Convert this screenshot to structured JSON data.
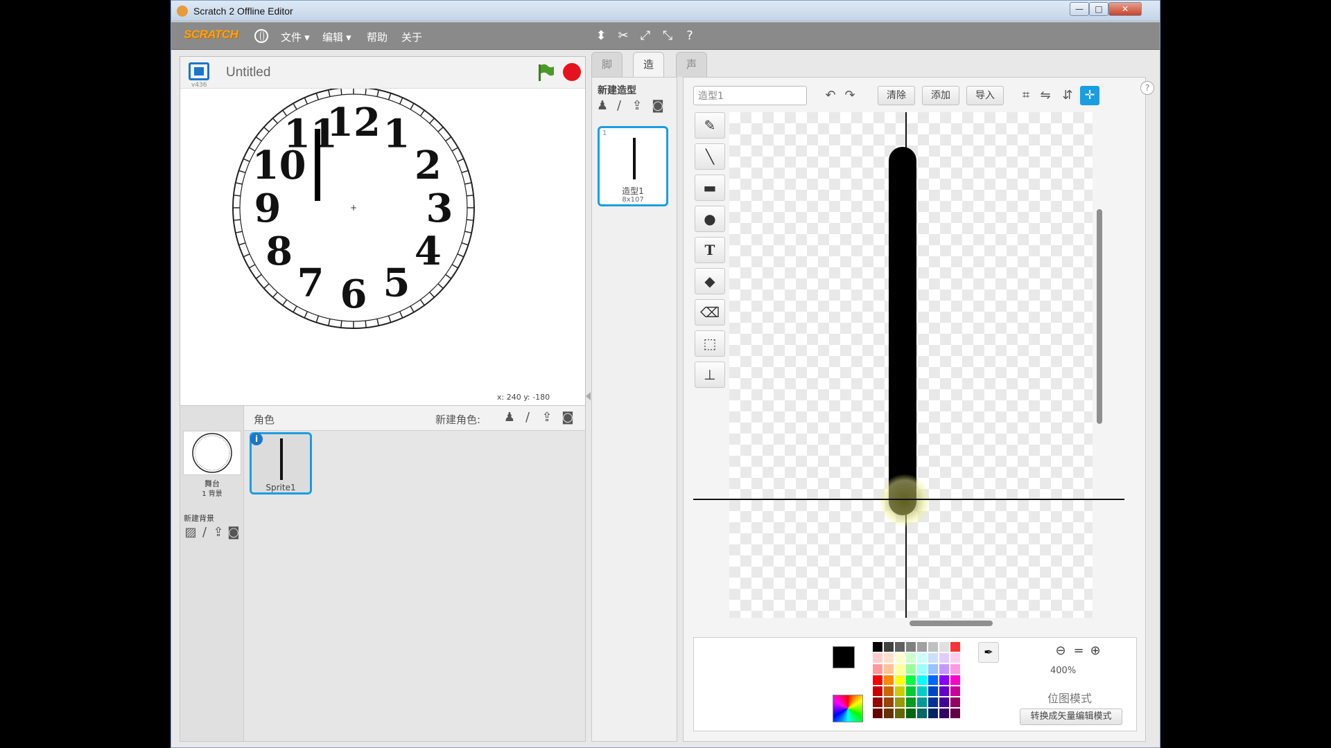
{
  "window": {
    "title": "Scratch 2 Offline Editor",
    "close_label": "✕",
    "min_label": "—",
    "max_label": "□"
  },
  "menubar": {
    "logo": "SCRATCH",
    "items": [
      "文件 ▾",
      "编辑 ▾",
      "帮助",
      "关于"
    ]
  },
  "stage": {
    "version": "v436",
    "project_title": "Untitled",
    "coords_x_label": "x:",
    "coords_x": "240",
    "coords_y_label": "y:",
    "coords_y": "-180",
    "clock_numbers": [
      "12",
      "1",
      "2",
      "3",
      "4",
      "5",
      "6",
      "7",
      "8",
      "9",
      "10",
      "11"
    ]
  },
  "sprites": {
    "header_label": "角色",
    "new_sprite_label": "新建角色:",
    "stage_label": "舞台",
    "stage_bg_count": "1 背景",
    "new_backdrop_label": "新建背景",
    "items": [
      {
        "name": "Sprite1",
        "info": "i"
      }
    ]
  },
  "tabs": [
    {
      "label": "脚本"
    },
    {
      "label": "造型"
    },
    {
      "label": "声音"
    }
  ],
  "costumes": {
    "new_costume_label": "新建造型",
    "items": [
      {
        "index": "1",
        "name": "造型1",
        "size": "8x107"
      }
    ]
  },
  "editor": {
    "costume_name": "造型1",
    "clear_label": "清除",
    "add_label": "添加",
    "import_label": "导入",
    "zoom_level": "400%",
    "mode_label": "位图模式",
    "convert_label": "转换成矢量编辑模式",
    "help": "?"
  },
  "colors": {
    "accent": "#1b9de2",
    "stop": "#e6121f",
    "flag": "#4a9a2a",
    "palette": [
      "#000000",
      "#404040",
      "#606060",
      "#808080",
      "#a0a0a0",
      "#c0c0c0",
      "#e0e0e0",
      "#ff3333",
      "#ffcccc",
      "#ffe0cc",
      "#ffffcc",
      "#ccffcc",
      "#ccffff",
      "#cce0ff",
      "#e0ccff",
      "#ffccf0",
      "#ff9999",
      "#ffc299",
      "#ffff99",
      "#99ff99",
      "#99ffff",
      "#99c2ff",
      "#c299ff",
      "#ff99e0",
      "#ff0000",
      "#ff8800",
      "#ffff00",
      "#00ff44",
      "#00ffff",
      "#0066ff",
      "#8800ff",
      "#ff00cc",
      "#cc0000",
      "#cc6600",
      "#cccc00",
      "#00cc33",
      "#00cccc",
      "#0044cc",
      "#6600cc",
      "#cc0099",
      "#990000",
      "#994400",
      "#999900",
      "#009922",
      "#009999",
      "#003399",
      "#440099",
      "#990066",
      "#660000",
      "#663300",
      "#666600",
      "#006611",
      "#006666",
      "#002266",
      "#330066",
      "#660044"
    ]
  },
  "icons": {
    "globe": "globe-icon",
    "toolbar": [
      "stamp-icon",
      "grow-icon",
      "shrink-icon",
      "fullscreen-icon",
      "help-icon"
    ],
    "tools": [
      "brush-icon",
      "line-icon",
      "rectangle-icon",
      "ellipse-icon",
      "text-icon",
      "fill-icon",
      "eraser-icon",
      "select-icon",
      "stamp-icon"
    ]
  }
}
